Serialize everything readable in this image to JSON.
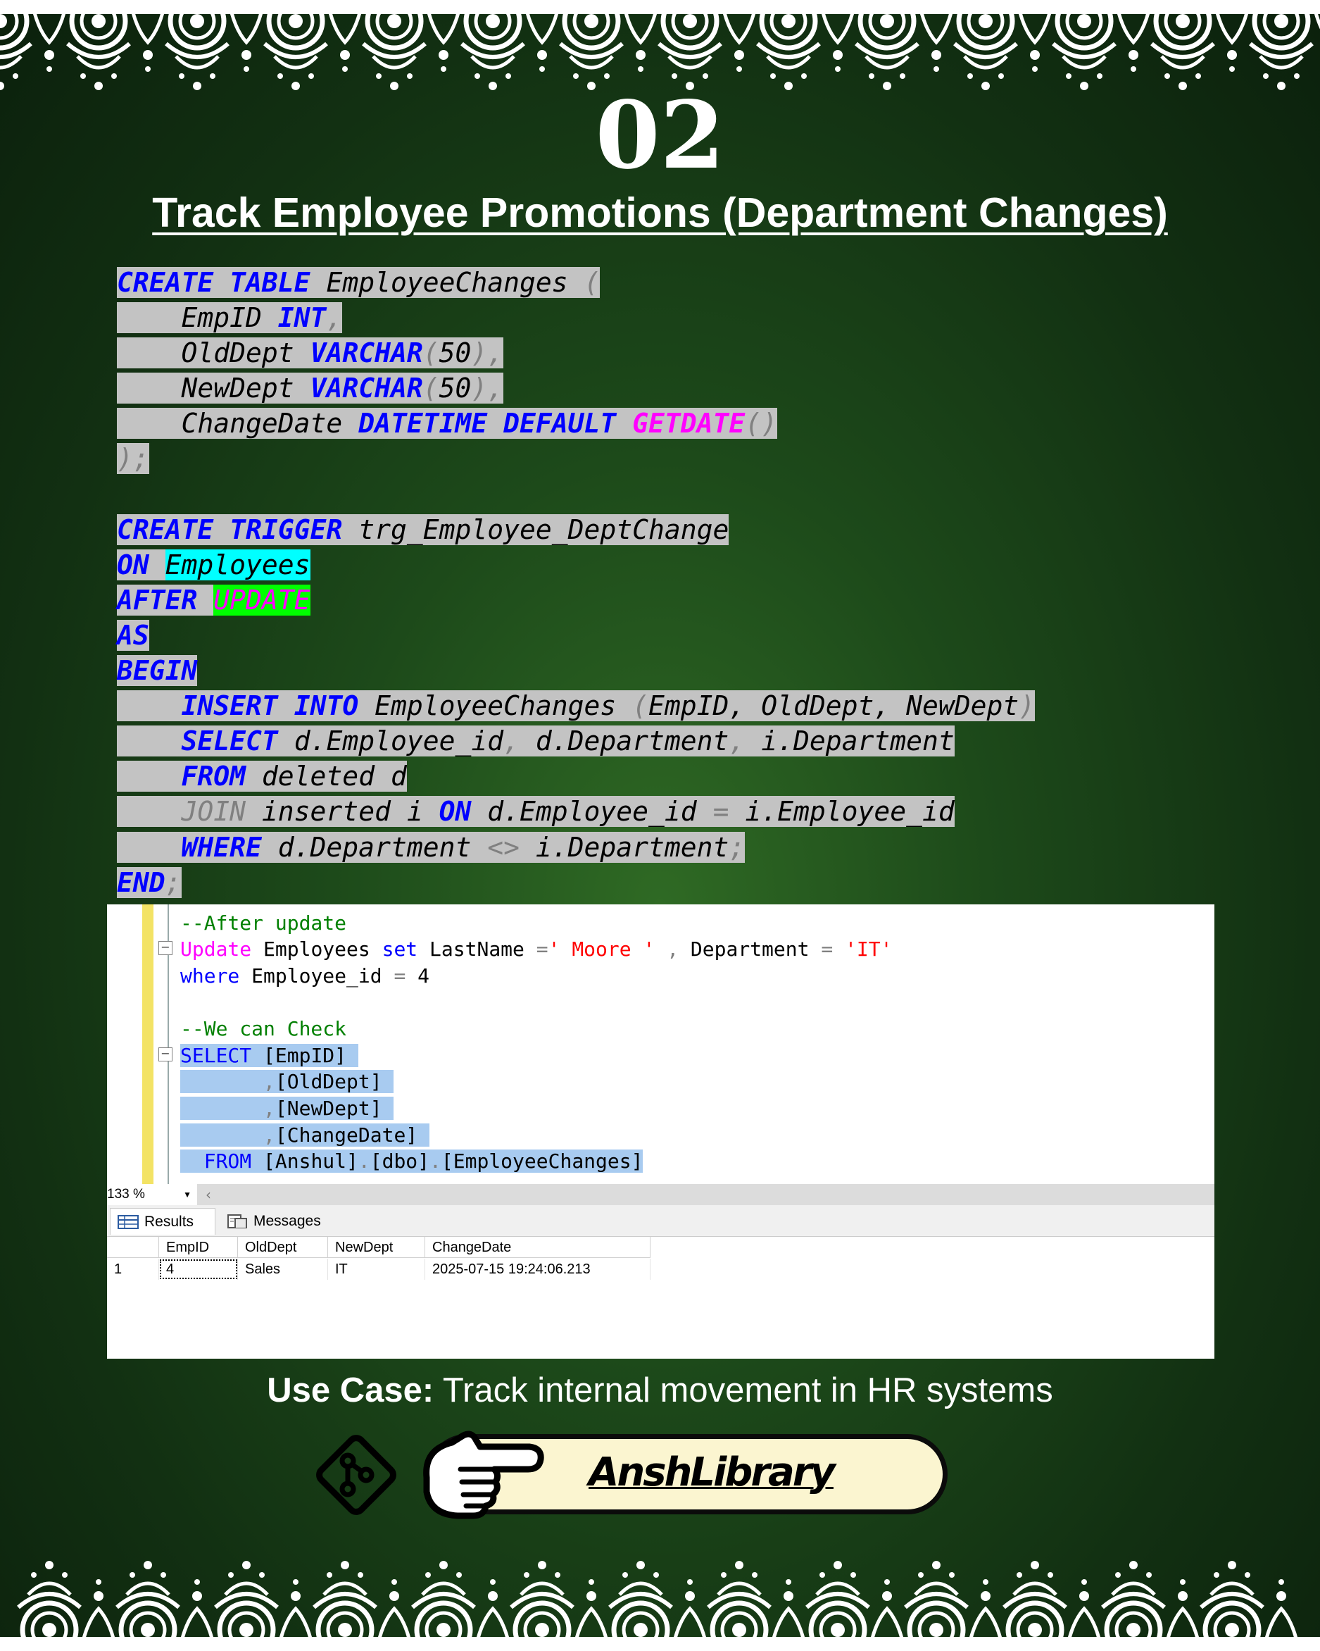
{
  "header": {
    "number": "02",
    "title": "Track Employee Promotions (Department Changes)"
  },
  "code": {
    "t1_create": "CREATE",
    "t1_table": "TABLE",
    "t1_name": "EmployeeChanges",
    "t1_paren": "(",
    "c1_name": "EmpID",
    "c1_type": "INT",
    "c2_name": "OldDept",
    "c3_name": "NewDept",
    "varchar": "VARCHAR",
    "len": "50",
    "c4_name": "ChangeDate",
    "c4_type": "DATETIME",
    "c4_default": "DEFAULT",
    "c4_func": "GETDATE",
    "t1_close": ");",
    "tr_create": "CREATE",
    "tr_trigger": "TRIGGER",
    "tr_name": "trg_Employee_DeptChange",
    "tr_on": "ON",
    "tr_table": "Employees",
    "tr_after": "AFTER",
    "tr_update": "UPDATE",
    "tr_as": "AS",
    "tr_begin": "BEGIN",
    "ins_insert": "INSERT",
    "ins_into": "INTO",
    "ins_table": "EmployeeChanges",
    "ins_cols": "EmpID, OldDept, NewDept",
    "sel_select": "SELECT",
    "sel_c1": "d.Employee_id",
    "sel_c2": "d.Department",
    "sel_c3": "i.Department",
    "from_from": "FROM",
    "from_src": "deleted d",
    "join_join": "JOIN",
    "join_src": "inserted i",
    "join_on": "ON",
    "join_left": "d.Employee_id",
    "join_right": "i.Employee_id",
    "where_where": "WHERE",
    "where_left": "d.Department",
    "where_op": "<>",
    "where_right": "i.Department",
    "end": "END"
  },
  "ssms": {
    "comment1": "--After update",
    "update_kw": "Update",
    "update_table": "Employees",
    "set_kw": "set",
    "update_col1": "LastName",
    "update_val1": "' Moore '",
    "update_col2": "Department",
    "update_val2": "'IT'",
    "where_kw": "where",
    "where_col": "Employee_id",
    "where_val": "4",
    "comment2": "--We can Check",
    "select_kw": "SELECT",
    "sel1": "[EmpID]",
    "sel2": "[OldDept]",
    "sel3": "[NewDept]",
    "sel4": "[ChangeDate]",
    "from_kw": "FROM",
    "from_db": "[Anshul]",
    "from_schema": "[dbo]",
    "from_table": "[EmployeeChanges]",
    "zoom": "133 %",
    "tab_results": "Results",
    "tab_messages": "Messages",
    "grid_headers": [
      "EmpID",
      "OldDept",
      "NewDept",
      "ChangeDate"
    ],
    "grid_rows": [
      {
        "rownum": "1",
        "EmpID": "4",
        "OldDept": "Sales",
        "NewDept": "IT",
        "ChangeDate": "2025-07-15 19:24:06.213"
      }
    ]
  },
  "footer": {
    "usecase_label": "Use Case:",
    "usecase_text": " Track internal movement in HR systems",
    "brand": "AnshLibrary",
    "icons": [
      "git-diamond-icon",
      "pointing-hand-icon"
    ]
  },
  "colors": {
    "keyword": "#0000ff",
    "function": "#ff00ff",
    "highlight": "#c3c3c3",
    "selection": "#a8cbf0",
    "pill": "#fbf5d0"
  }
}
